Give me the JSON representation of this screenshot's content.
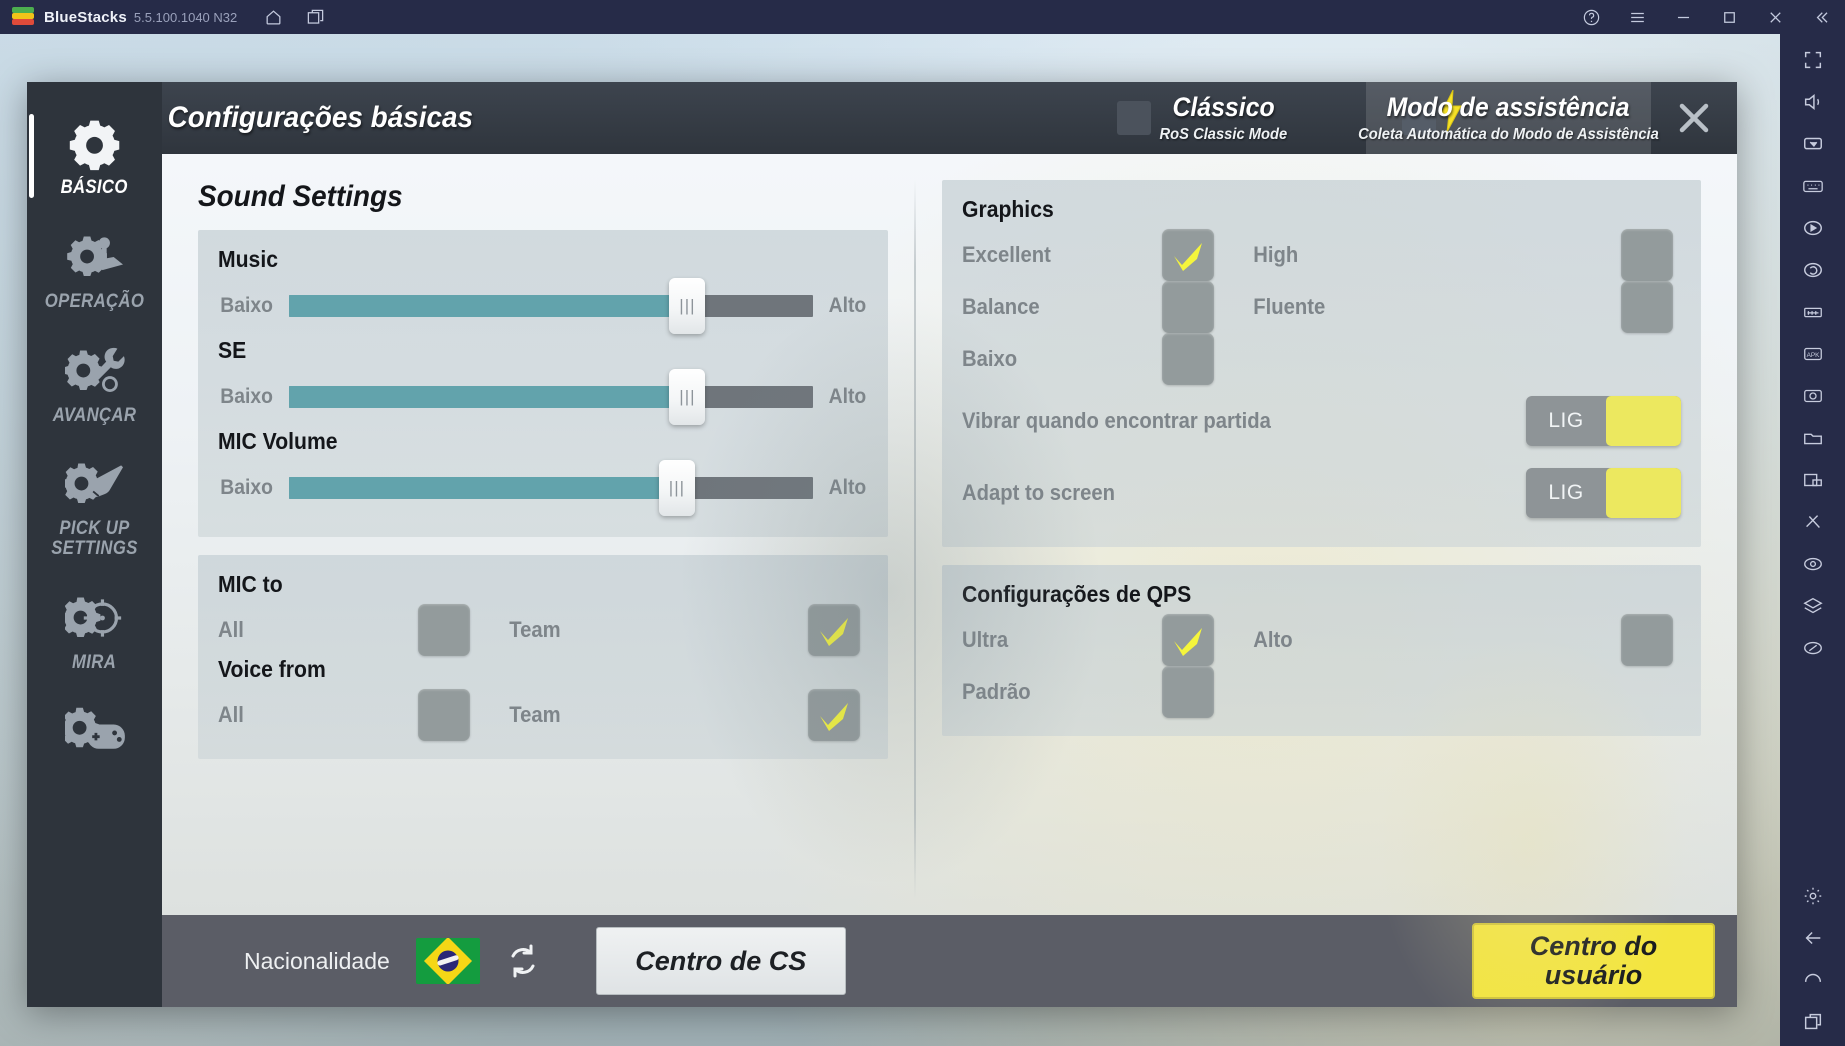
{
  "window": {
    "app_name": "BlueStacks",
    "version": "5.5.100.1040 N32",
    "icons": {
      "logo": "bluestacks-logo",
      "home": "home-icon",
      "instances": "multi-instance-icon",
      "help": "help-icon",
      "menu": "hamburger-menu-icon",
      "minimize": "minimize-icon",
      "maximize": "maximize-icon",
      "close": "close-icon",
      "collapse": "collapse-icon"
    }
  },
  "toolbar_right": {
    "items": [
      "fullscreen-icon",
      "volume-icon",
      "cursor-icon",
      "keyboard-icon",
      "record-icon",
      "rotate-icon",
      "macro-icon",
      "apk-install-icon",
      "screenshot-icon",
      "folder-icon",
      "window-icon",
      "trim-icon",
      "eye-icon",
      "layers-icon",
      "pointer-icon"
    ],
    "bottom_items": [
      "gear-icon",
      "back-icon",
      "home-icon",
      "recents-icon"
    ]
  },
  "dialog": {
    "title": "Configurações básicas",
    "close_label": "×",
    "sidebar": {
      "items": [
        {
          "label": "BÁSICO",
          "icon": "gear-icon",
          "active": true
        },
        {
          "label": "OPERAÇÃO",
          "icon": "joystick-gear-icon",
          "active": false
        },
        {
          "label": "AVANÇAR",
          "icon": "wrench-gear-icon",
          "active": false
        },
        {
          "label": "PICK UP SETTINGS",
          "icon": "hand-gear-icon",
          "active": false
        },
        {
          "label": "MIRA",
          "icon": "crosshair-gear-icon",
          "active": false
        },
        {
          "label": "",
          "icon": "gamepad-gear-icon",
          "active": false
        }
      ]
    },
    "tabs": [
      {
        "title": "Clássico",
        "subtitle": "RoS Classic Mode",
        "selected": false
      },
      {
        "title": "Modo de assistência",
        "subtitle": "Coleta Automática do Modo de Assistência",
        "selected": true
      }
    ]
  },
  "left_column": {
    "section_title": "Sound Settings",
    "sliders": [
      {
        "name": "Music",
        "min_label": "Baixo",
        "max_label": "Alto",
        "value": 76
      },
      {
        "name": "SE",
        "min_label": "Baixo",
        "max_label": "Alto",
        "value": 76
      },
      {
        "name": "MIC Volume",
        "min_label": "Baixo",
        "max_label": "Alto",
        "value": 74
      }
    ],
    "mic_to": {
      "title": "MIC to",
      "option_left": "All",
      "option_left_checked": false,
      "option_right": "Team",
      "option_right_checked": true
    },
    "voice_from": {
      "title": "Voice from",
      "option_left": "All",
      "option_left_checked": false,
      "option_right": "Team",
      "option_right_checked": true
    }
  },
  "right_column": {
    "graphics": {
      "title": "Graphics",
      "rows": [
        {
          "left_label": "Excellent",
          "left_checked": true,
          "right_label": "High",
          "right_checked": false
        },
        {
          "left_label": "Balance",
          "left_checked": false,
          "right_label": "Fluente",
          "right_checked": false
        },
        {
          "left_label": "Baixo",
          "left_checked": false,
          "right_label": "",
          "right_checked": null
        }
      ],
      "toggles": [
        {
          "label": "Vibrar quando encontrar partida",
          "state_label": "LIG",
          "on": true
        },
        {
          "label": "Adapt to screen",
          "state_label": "LIG",
          "on": true
        }
      ]
    },
    "qps": {
      "title": "Configurações de QPS",
      "rows": [
        {
          "left_label": "Ultra",
          "left_checked": true,
          "right_label": "Alto",
          "right_checked": false
        },
        {
          "left_label": "Padrão",
          "left_checked": false,
          "right_label": "",
          "right_checked": null
        }
      ]
    }
  },
  "footer": {
    "nationality_label": "Nacionalidade",
    "flag": "brazil-flag",
    "refresh_icon": "refresh-icon",
    "cs_button": "Centro de CS",
    "user_button_line1": "Centro do",
    "user_button_line2": "usuário"
  },
  "colors": {
    "accent_yellow": "#f3e53f",
    "check_yellow": "#f5f53c",
    "slider_fill": "#62a3ac",
    "slider_track": "#6f757b",
    "checkbox_gray": "#939b9c",
    "titlebar": "#262b48",
    "nav_dark": "#2e343c"
  }
}
